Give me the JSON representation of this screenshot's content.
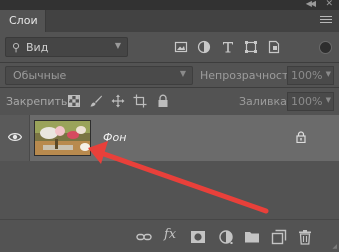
{
  "panel": {
    "tab_label": "Слои",
    "collapse_icon": "double-chevron-right-icon",
    "close_icon": "close-icon",
    "menu_icon": "hamburger-menu-icon"
  },
  "filter": {
    "kind_label": "Вид",
    "kind_icon": "search-icon",
    "filter_icons": [
      "image-filter-icon",
      "adjustment-filter-icon",
      "type-filter-icon",
      "shape-filter-icon",
      "smart-object-filter-icon"
    ],
    "toggle_icon": "filter-toggle-icon"
  },
  "blend": {
    "mode_value": "Обычные",
    "opacity_label": "Непрозрачность:",
    "opacity_value": "100%"
  },
  "lock": {
    "label": "Закрепить:",
    "icons": [
      "lock-transparent-pixels-icon",
      "lock-image-pixels-icon",
      "lock-position-icon",
      "lock-artboard-icon",
      "lock-all-icon"
    ],
    "fill_label": "Заливка:",
    "fill_value": "100%"
  },
  "layers": [
    {
      "name": "Фон",
      "visible": true,
      "locked": true,
      "selected": true
    }
  ],
  "annotation": {
    "arrow_color": "#e8403a"
  },
  "bottom_toolbar": {
    "icons": [
      "link-layers-icon",
      "fx-icon",
      "add-mask-icon",
      "adjustment-layer-icon",
      "new-group-icon",
      "new-layer-icon",
      "delete-layer-icon"
    ],
    "fx_label": "fx"
  }
}
